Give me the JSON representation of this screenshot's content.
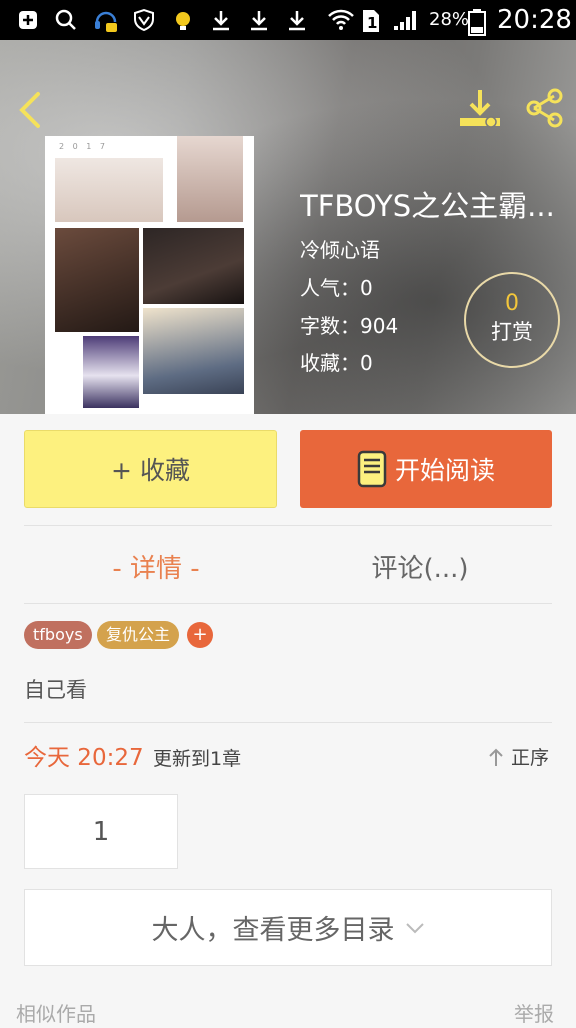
{
  "status_bar": {
    "battery_percent": "28%",
    "time": "20:28",
    "sim_slot": "1",
    "icons": [
      "plus-square-icon",
      "search-icon",
      "headset-chat-icon",
      "shield-v-icon",
      "bulb-icon",
      "download-icon",
      "download-icon",
      "download-icon",
      "wifi-icon",
      "sim-icon",
      "signal-icon",
      "battery-icon"
    ]
  },
  "header": {
    "back_icon": "chevron-left-icon",
    "download_icon": "download-icon",
    "share_icon": "share-icon"
  },
  "book": {
    "title": "TFBOYS之公主霸...",
    "author": "冷倾心语",
    "popularity": "人气：0",
    "word_count": "字数：904",
    "favorites": "收藏：0",
    "tip_count": "0",
    "tip_label": "打赏",
    "cover_caption": "2 0 1 7"
  },
  "actions": {
    "collect_label": "+ 收藏",
    "read_label": "开始阅读",
    "read_icon": "book-icon"
  },
  "tabs": {
    "detail": "- 详情 -",
    "comments": "评论(...)"
  },
  "tags": [
    {
      "label": "tfboys",
      "color": "#c0705f"
    },
    {
      "label": "复仇公主",
      "color": "#d4a24c"
    }
  ],
  "tag_add": "+",
  "intro": "自己看",
  "update": {
    "time": "今天 20:27",
    "info": "更新到1章",
    "sort_label": "正序"
  },
  "chapters": [
    "1"
  ],
  "more_toc": "大人，查看更多目录",
  "footer": {
    "similar": "相似作品",
    "report": "举报"
  },
  "colors": {
    "accent_orange": "#e8673b",
    "collect_yellow": "#fdf17f",
    "icon_yellow": "#f5e25a",
    "tab_active": "#e9814f"
  }
}
